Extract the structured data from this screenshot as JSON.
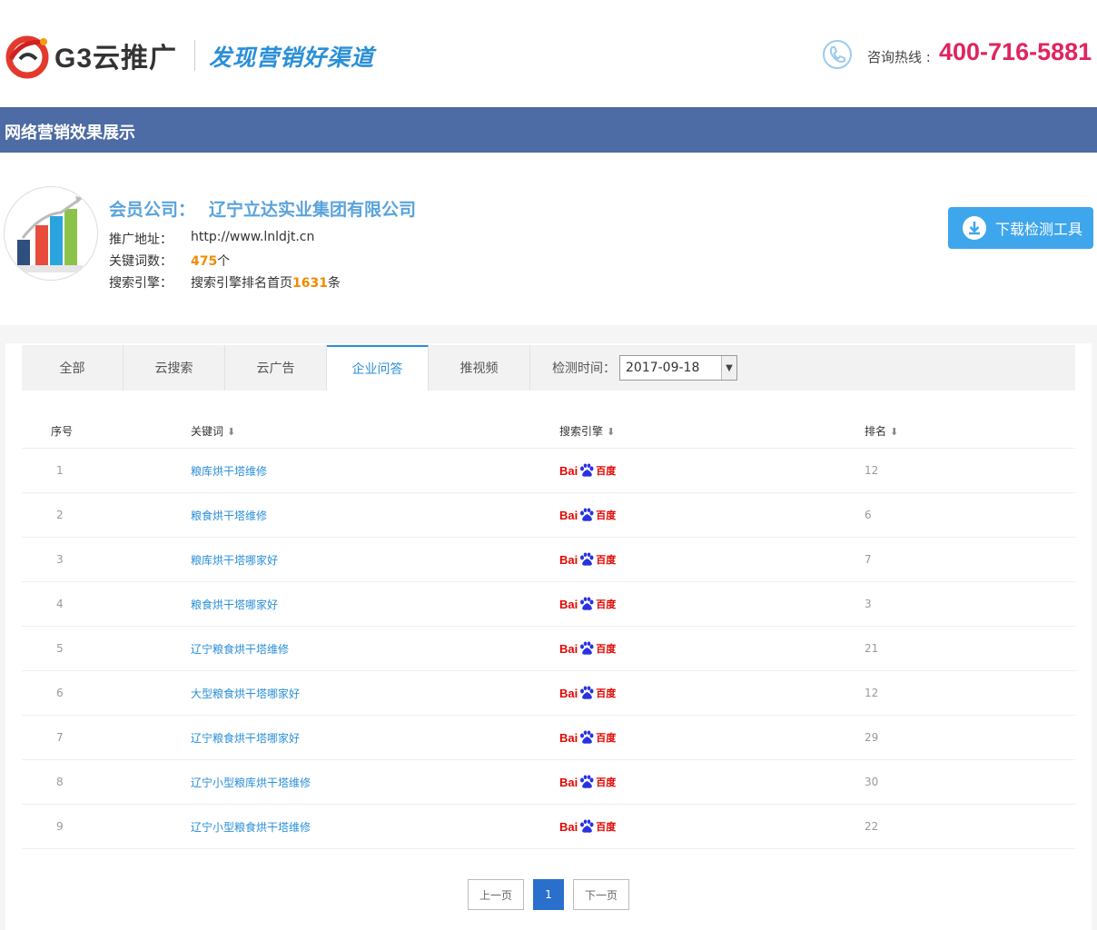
{
  "header": {
    "logo_text": "G3云推广",
    "slogan": "发现营销好渠道",
    "hotline_label": "咨询热线 :",
    "hotline_number": "400-716-5881"
  },
  "section": {
    "title": "网络营销效果展示"
  },
  "company": {
    "member_label": "会员公司：",
    "name": "辽宁立达实业集团有限公司",
    "url_label": "推广地址：",
    "url": "http://www.lnldjt.cn",
    "keywords_label": "关键词数：",
    "keywords_count": "475",
    "keywords_unit": "个",
    "engine_label": "搜索引擎：",
    "engine_prefix": "搜索引擎排名首页",
    "engine_count": "1631",
    "engine_unit": "条",
    "download_label": "下载检测工具"
  },
  "tabs": [
    {
      "label": "全部"
    },
    {
      "label": "云搜索"
    },
    {
      "label": "云广告"
    },
    {
      "label": "企业问答"
    },
    {
      "label": "推视频"
    }
  ],
  "active_tab": "企业问答",
  "date_filter": {
    "label": "检测时间：",
    "value": "2017-09-18"
  },
  "table": {
    "headers": {
      "index": "序号",
      "keyword": "关键词",
      "engine": "搜索引擎",
      "rank": "排名"
    },
    "engine_logo": {
      "left": "Bai",
      "right": "百度"
    },
    "rows": [
      {
        "index": "1",
        "keyword": "粮库烘干塔维修",
        "rank": "12"
      },
      {
        "index": "2",
        "keyword": "粮食烘干塔维修",
        "rank": "6"
      },
      {
        "index": "3",
        "keyword": "粮库烘干塔哪家好",
        "rank": "7"
      },
      {
        "index": "4",
        "keyword": "粮食烘干塔哪家好",
        "rank": "3"
      },
      {
        "index": "5",
        "keyword": "辽宁粮食烘干塔维修",
        "rank": "21"
      },
      {
        "index": "6",
        "keyword": "大型粮食烘干塔哪家好",
        "rank": "12"
      },
      {
        "index": "7",
        "keyword": "辽宁粮食烘干塔哪家好",
        "rank": "29"
      },
      {
        "index": "8",
        "keyword": "辽宁小型粮库烘干塔维修",
        "rank": "30"
      },
      {
        "index": "9",
        "keyword": "辽宁小型粮食烘干塔维修",
        "rank": "22"
      }
    ]
  },
  "pager": {
    "prev": "上一页",
    "current": "1",
    "next": "下一页"
  },
  "colors": {
    "accent": "#2a8fd8",
    "bar": "#4d6ba4",
    "hotline": "#e0245e",
    "orange": "#f08c00"
  }
}
